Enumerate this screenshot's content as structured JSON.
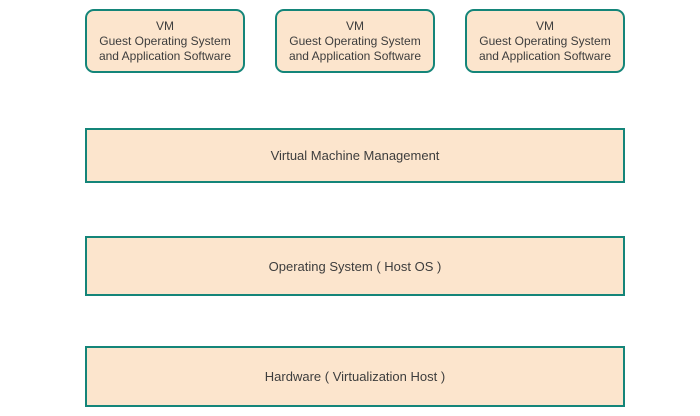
{
  "diagram": {
    "name": "virtualization-architecture-diagram",
    "colors": {
      "box_fill": "#fce5cd",
      "box_border": "#148579",
      "text": "#3d3d3d"
    },
    "vm_row": {
      "boxes": [
        {
          "lines": [
            "VM",
            "Guest Operating System",
            "and Application Software"
          ]
        },
        {
          "lines": [
            "VM",
            "Guest Operating System",
            "and Application Software"
          ]
        },
        {
          "lines": [
            "VM",
            "Guest Operating System",
            "and Application Software"
          ]
        }
      ]
    },
    "layers": [
      {
        "label": "Virtual Machine Management"
      },
      {
        "label": "Operating System ( Host OS )"
      },
      {
        "label": "Hardware ( Virtualization Host )"
      }
    ]
  }
}
